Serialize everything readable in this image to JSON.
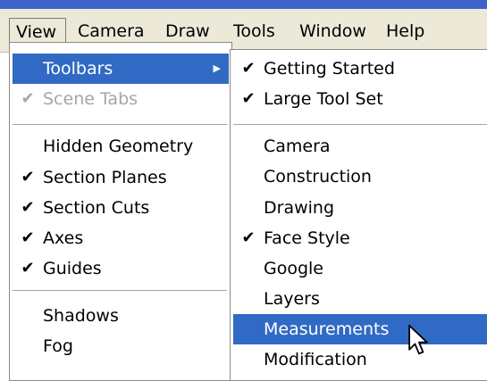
{
  "menubar": {
    "items": [
      {
        "label": "View",
        "active": true
      },
      {
        "label": "Camera"
      },
      {
        "label": "Draw"
      },
      {
        "label": "Tools"
      },
      {
        "label": "Window"
      },
      {
        "label": "Help"
      }
    ]
  },
  "view_menu": {
    "items": [
      {
        "label": "Toolbars",
        "submenu": true,
        "highlighted": true
      },
      {
        "label": "Scene Tabs",
        "checked": true,
        "disabled": true
      },
      {
        "label": "Hidden Geometry"
      },
      {
        "label": "Section Planes",
        "checked": true
      },
      {
        "label": "Section Cuts",
        "checked": true
      },
      {
        "label": "Axes",
        "checked": true
      },
      {
        "label": "Guides",
        "checked": true
      },
      {
        "label": "Shadows"
      },
      {
        "label": "Fog"
      }
    ]
  },
  "toolbars_submenu": {
    "items": [
      {
        "label": "Getting Started",
        "checked": true
      },
      {
        "label": "Large Tool Set",
        "checked": true
      },
      {
        "label": "Camera"
      },
      {
        "label": "Construction"
      },
      {
        "label": "Drawing"
      },
      {
        "label": "Face Style",
        "checked": true
      },
      {
        "label": "Google"
      },
      {
        "label": "Layers"
      },
      {
        "label": "Measurements",
        "highlighted": true
      },
      {
        "label": "Modification"
      }
    ]
  },
  "glyphs": {
    "check": "✔",
    "submenu_arrow": "▶"
  },
  "colors": {
    "highlight": "#316ac5",
    "menubar": "#ece9d8",
    "disabled_text": "#a7a6a0"
  }
}
